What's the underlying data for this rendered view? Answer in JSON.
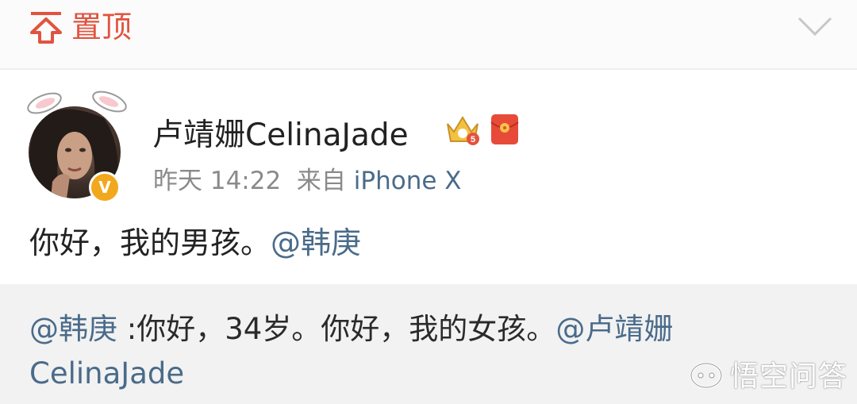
{
  "top_bar": {
    "pin_label": "置顶",
    "pin_icon": "pin-top-icon",
    "collapse_icon": "chevron-down-icon"
  },
  "post": {
    "username": "卢靖姗CelinaJade",
    "time": "昨天 14:22",
    "source_prefix": "来自",
    "source_device": "iPhone X",
    "text": "你好，我的男孩。",
    "mention": "@韩庚",
    "badges": [
      "crown-vip-icon",
      "red-packet-icon"
    ],
    "verified_badge": "V"
  },
  "repost": {
    "mention": "@韩庚",
    "text": " :你好，34岁。你好，我的女孩。",
    "mention2_part1": "@卢靖姗",
    "mention2_part2": "CelinaJade"
  },
  "watermark": {
    "text": "悟空问答"
  },
  "colors": {
    "accent_red": "#e2533f",
    "link_blue": "#4a6b8a",
    "meta_gray": "#8a8a8a",
    "verified_gold": "#f2a81d",
    "repost_bg": "#f2f2f2"
  }
}
